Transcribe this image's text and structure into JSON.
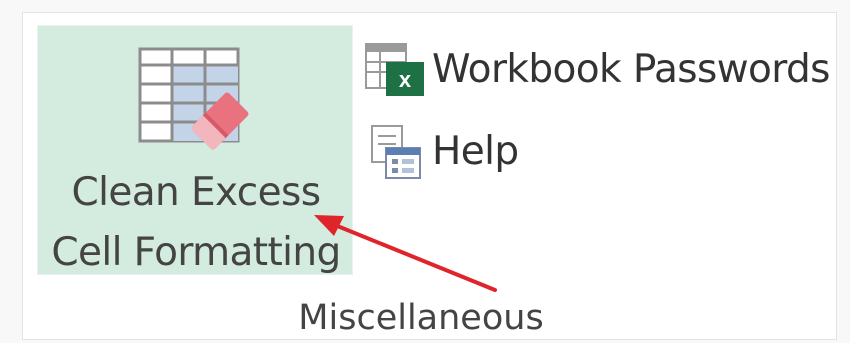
{
  "ribbon": {
    "big_button": {
      "label_line1": "Clean Excess",
      "label_line2": "Cell Formatting",
      "icon": "table-eraser-icon"
    },
    "small_buttons": [
      {
        "label": "Workbook Passwords",
        "icon": "workbook-passwords-icon"
      },
      {
        "label": "Help",
        "icon": "help-icon"
      }
    ],
    "group_label": "Miscellaneous"
  },
  "annotation": {
    "arrow_color": "#e0242b",
    "arrow_icon": "red-arrow"
  },
  "colors": {
    "highlight": "#d4ecdf",
    "excel_green": "#1e7145",
    "eraser_pink": "#e8737f"
  }
}
